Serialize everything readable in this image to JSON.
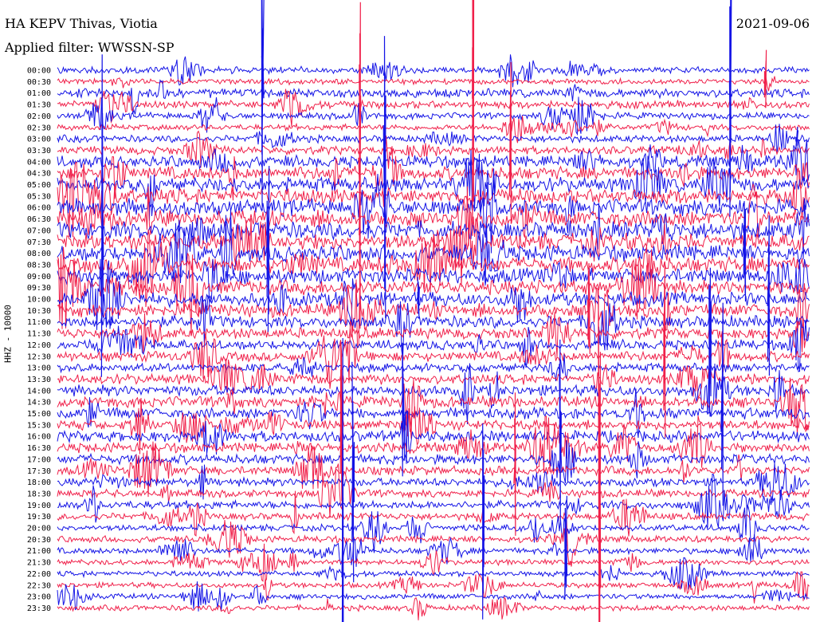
{
  "header": {
    "station": "HA KEPV Thivas, Viotia",
    "filter": "Applied filter: WWSSN-SP",
    "date": "2021-09-06"
  },
  "chart_data": {
    "type": "helicorder",
    "ylabel": "HHZ - 10000",
    "tick_labels": [
      "00:00",
      "00:30",
      "01:00",
      "01:30",
      "02:00",
      "02:30",
      "03:00",
      "03:30",
      "04:00",
      "04:30",
      "05:00",
      "05:30",
      "06:00",
      "06:30",
      "07:00",
      "07:30",
      "08:00",
      "08:30",
      "09:00",
      "09:30",
      "10:00",
      "10:30",
      "11:00",
      "11:30",
      "12:00",
      "12:30",
      "13:00",
      "13:30",
      "14:00",
      "14:30",
      "15:00",
      "15:30",
      "16:00",
      "16:30",
      "17:00",
      "17:30",
      "18:00",
      "18:30",
      "19:00",
      "19:30",
      "20:00",
      "20:30",
      "21:00",
      "21:30",
      "22:00",
      "22:30",
      "23:00",
      "23:30"
    ],
    "trace_colors": [
      "#1414e6",
      "#f0204a"
    ],
    "row_noise_levels": [
      1.2,
      1.0,
      1.6,
      1.4,
      1.2,
      1.1,
      1.3,
      1.5,
      2.2,
      2.4,
      2.6,
      2.8,
      3.0,
      3.0,
      3.2,
      3.0,
      3.0,
      2.8,
      2.8,
      2.6,
      2.6,
      2.4,
      2.2,
      2.0,
      1.8,
      1.8,
      1.6,
      1.8,
      2.0,
      2.0,
      2.0,
      1.8,
      2.0,
      1.8,
      1.8,
      1.6,
      1.5,
      1.4,
      1.5,
      1.3,
      1.2,
      1.2,
      1.1,
      1.0,
      1.0,
      1.0,
      1.0,
      1.0
    ]
  }
}
